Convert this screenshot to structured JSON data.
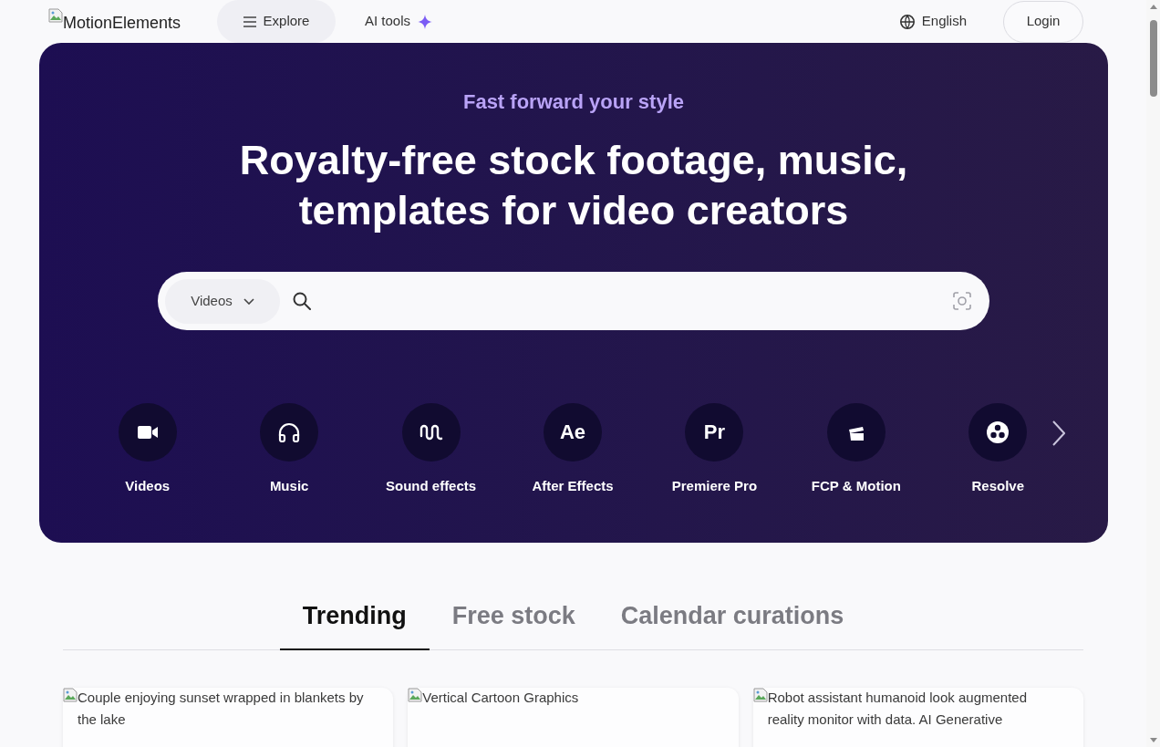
{
  "header": {
    "logo": {
      "alt": "MotionElements"
    },
    "nav": [
      {
        "label": "Explore",
        "kind": "menu"
      },
      {
        "label": "AI tools",
        "kind": "ai"
      }
    ],
    "language": "English",
    "login": "Login"
  },
  "hero": {
    "tagline": "Fast forward your style",
    "headline": [
      "Royalty-free stock footage, music,",
      "templates for video creators"
    ],
    "search": {
      "category": "Videos"
    },
    "categories": [
      {
        "label": "Videos",
        "kind": "video"
      },
      {
        "label": "Music",
        "kind": "headphones"
      },
      {
        "label": "Sound effects",
        "kind": "waveform"
      },
      {
        "label": "After Effects",
        "kind": "monogram",
        "glyph": "Ae"
      },
      {
        "label": "Premiere Pro",
        "kind": "monogram",
        "glyph": "Pr"
      },
      {
        "label": "FCP & Motion",
        "kind": "clapperboard"
      },
      {
        "label": "Resolve",
        "kind": "reels"
      }
    ]
  },
  "tabs": [
    {
      "label": "Trending",
      "selected": true
    },
    {
      "label": "Free stock",
      "selected": false
    },
    {
      "label": "Calendar curations",
      "selected": false
    }
  ],
  "cards": [
    {
      "alt": "Couple enjoying sunset wrapped in blankets by the lake"
    },
    {
      "alt": "Vertical Cartoon Graphics"
    },
    {
      "alt": "Robot assistant humanoid look augmented reality monitor with data. AI Generative"
    }
  ]
}
